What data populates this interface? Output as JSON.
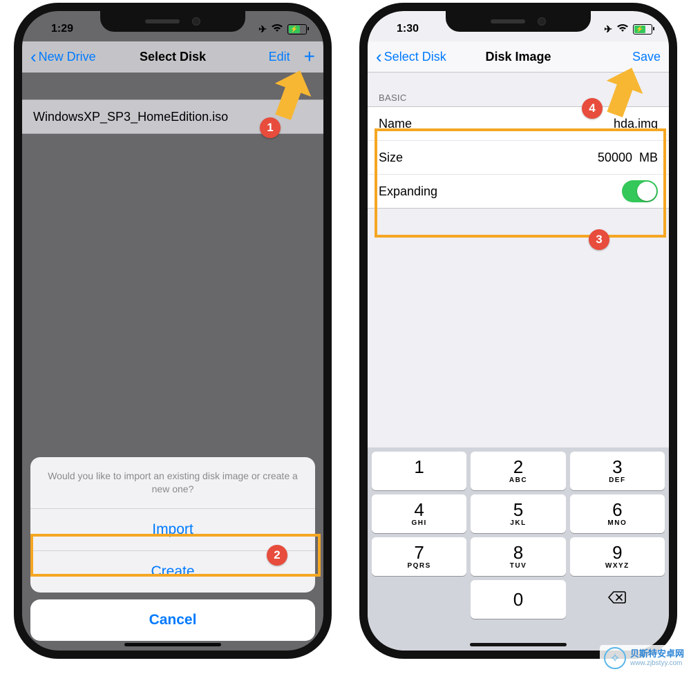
{
  "left": {
    "status_time": "1:29",
    "nav_back": "New Drive",
    "nav_title": "Select Disk",
    "nav_edit": "Edit",
    "list_item": "WindowsXP_SP3_HomeEdition.iso",
    "sheet_msg": "Would you like to import an existing disk image or create a new one?",
    "sheet_import": "Import",
    "sheet_create": "Create",
    "sheet_cancel": "Cancel"
  },
  "right": {
    "status_time": "1:30",
    "nav_back": "Select Disk",
    "nav_title": "Disk Image",
    "nav_save": "Save",
    "section_header": "BASIC",
    "row_name_label": "Name",
    "row_name_value": "hda.img",
    "row_size_label": "Size",
    "row_size_value": "50000",
    "row_size_unit": "MB",
    "row_expanding_label": "Expanding",
    "expanding_on": true,
    "keypad": [
      [
        "1",
        ""
      ],
      [
        "2",
        "ABC"
      ],
      [
        "3",
        "DEF"
      ],
      [
        "4",
        "GHI"
      ],
      [
        "5",
        "JKL"
      ],
      [
        "6",
        "MNO"
      ],
      [
        "7",
        "PQRS"
      ],
      [
        "8",
        "TUV"
      ],
      [
        "9",
        "WXYZ"
      ],
      [
        "",
        ""
      ],
      [
        "0",
        ""
      ],
      [
        "⌫",
        ""
      ]
    ]
  },
  "annotations": {
    "1": "1",
    "2": "2",
    "3": "3",
    "4": "4",
    "highlight_color": "#f5a623"
  },
  "watermark": {
    "line1": "贝斯特安卓网",
    "line2": "www.zjbstyy.com",
    "glyph": "✧"
  }
}
